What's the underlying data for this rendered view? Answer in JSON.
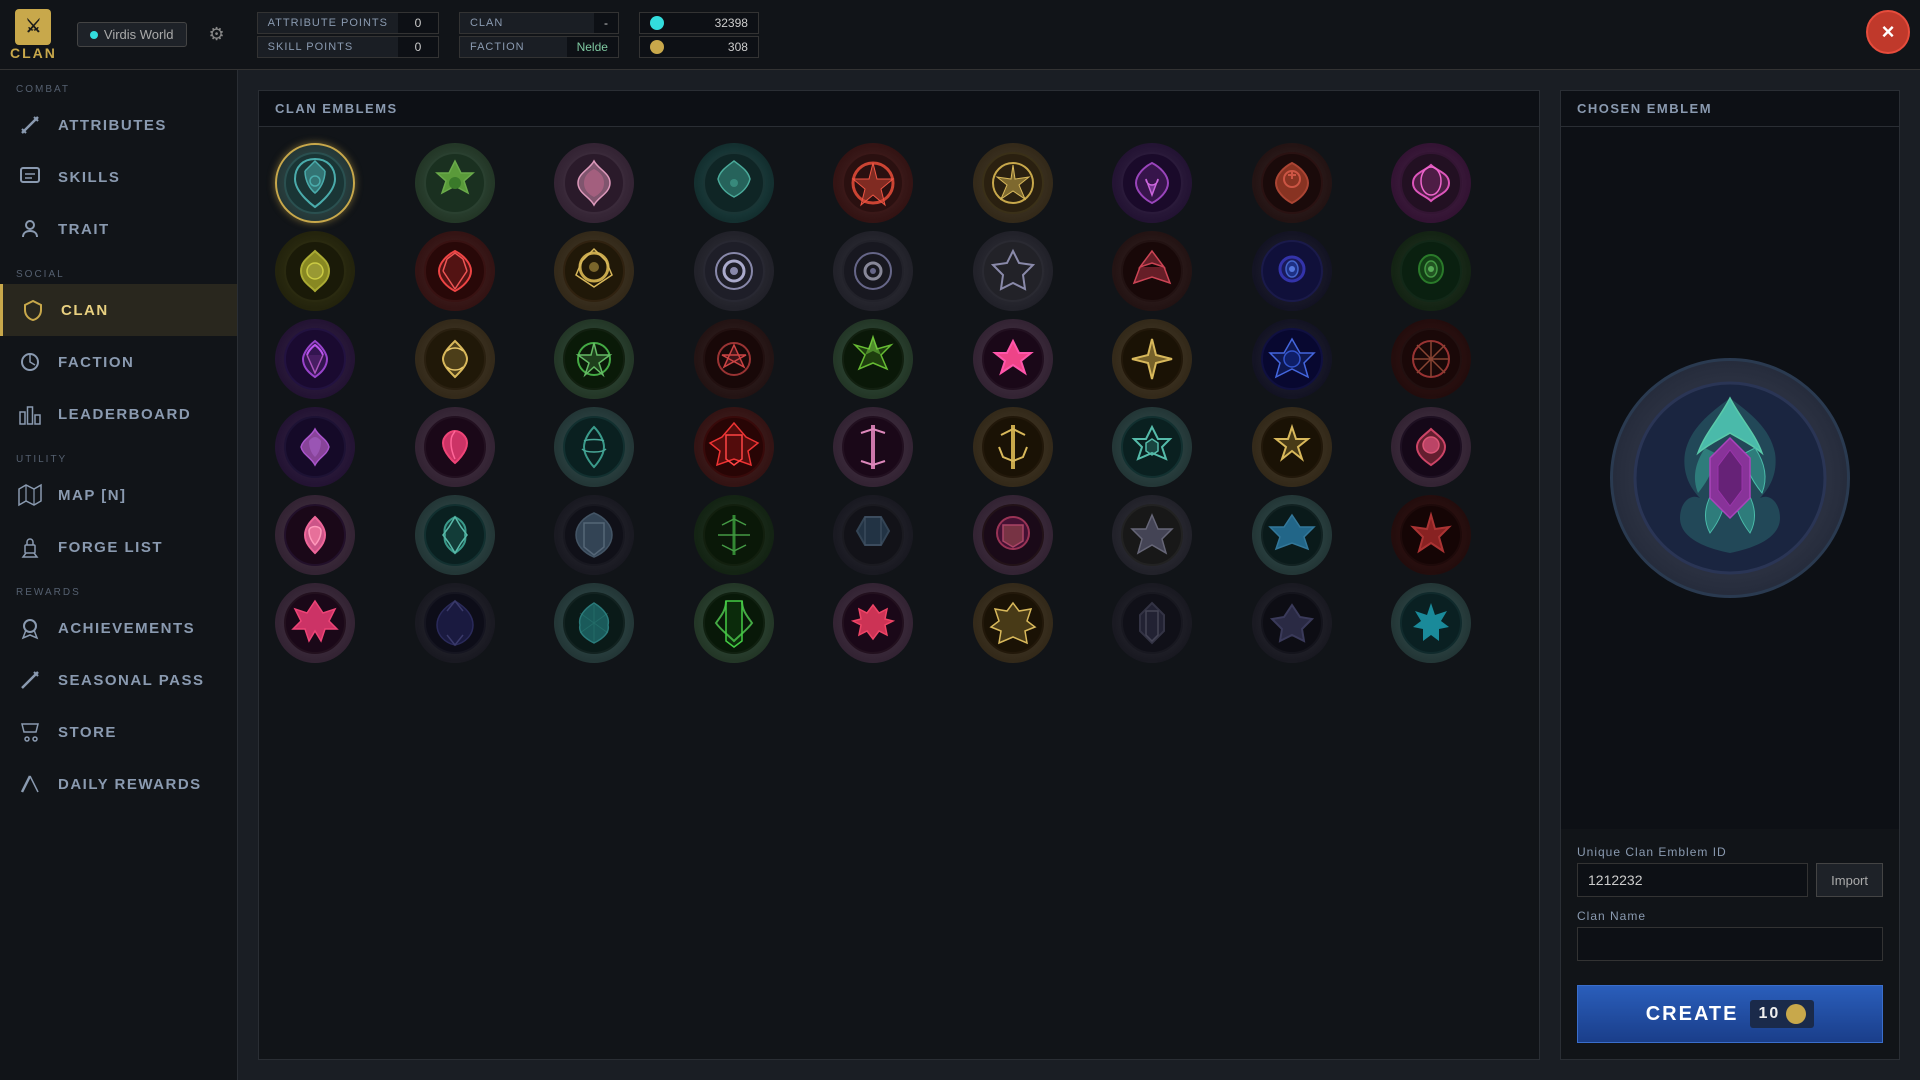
{
  "topbar": {
    "logo_text": "CLAN",
    "tab_world": "Virdis World",
    "attr_points_label": "ATTRIBUTE POINTS",
    "attr_points_value": "0",
    "skill_points_label": "SKILL POINTS",
    "skill_points_value": "0",
    "clan_label": "CLAN",
    "clan_value": "-",
    "faction_label": "FACTION",
    "faction_value": "Nelde",
    "currency1_value": "32398",
    "currency2_value": "308",
    "close_label": "×"
  },
  "sidebar": {
    "combat_label": "COMBAT",
    "social_label": "SOCIAL",
    "utility_label": "UTILITY",
    "rewards_label": "REWARDS",
    "items": [
      {
        "id": "attributes",
        "label": "ATTRIBUTES",
        "icon": "⚔"
      },
      {
        "id": "skills",
        "label": "SKILLS",
        "icon": "📖"
      },
      {
        "id": "trait",
        "label": "TRAIT",
        "icon": "🎭"
      },
      {
        "id": "clan",
        "label": "CLAN",
        "icon": "🛡",
        "active": true
      },
      {
        "id": "faction",
        "label": "FACTION",
        "icon": "⚜"
      },
      {
        "id": "leaderboard",
        "label": "LEADERBOARD",
        "icon": "🏆"
      },
      {
        "id": "map",
        "label": "MAP [N]",
        "icon": "🗺"
      },
      {
        "id": "forge",
        "label": "FORGE LIST",
        "icon": "🔨"
      },
      {
        "id": "achievements",
        "label": "ACHIEVEMENTS",
        "icon": "🏅"
      },
      {
        "id": "seasonal",
        "label": "SEASONAL PASS",
        "icon": "⚔"
      },
      {
        "id": "store",
        "label": "STORE",
        "icon": "🛒"
      },
      {
        "id": "daily",
        "label": "DAILY REWARDS",
        "icon": "🗡"
      }
    ]
  },
  "emblems_panel": {
    "header": "CLAN EMBLEMS"
  },
  "right_panel": {
    "header": "CHOSEN EMBLEM",
    "emblem_id_label": "Unique Clan Emblem ID",
    "emblem_id_value": "1212232",
    "import_label": "Import",
    "clan_name_label": "Clan Name",
    "clan_name_value": "",
    "create_label": "CREATE",
    "create_cost": "10"
  }
}
